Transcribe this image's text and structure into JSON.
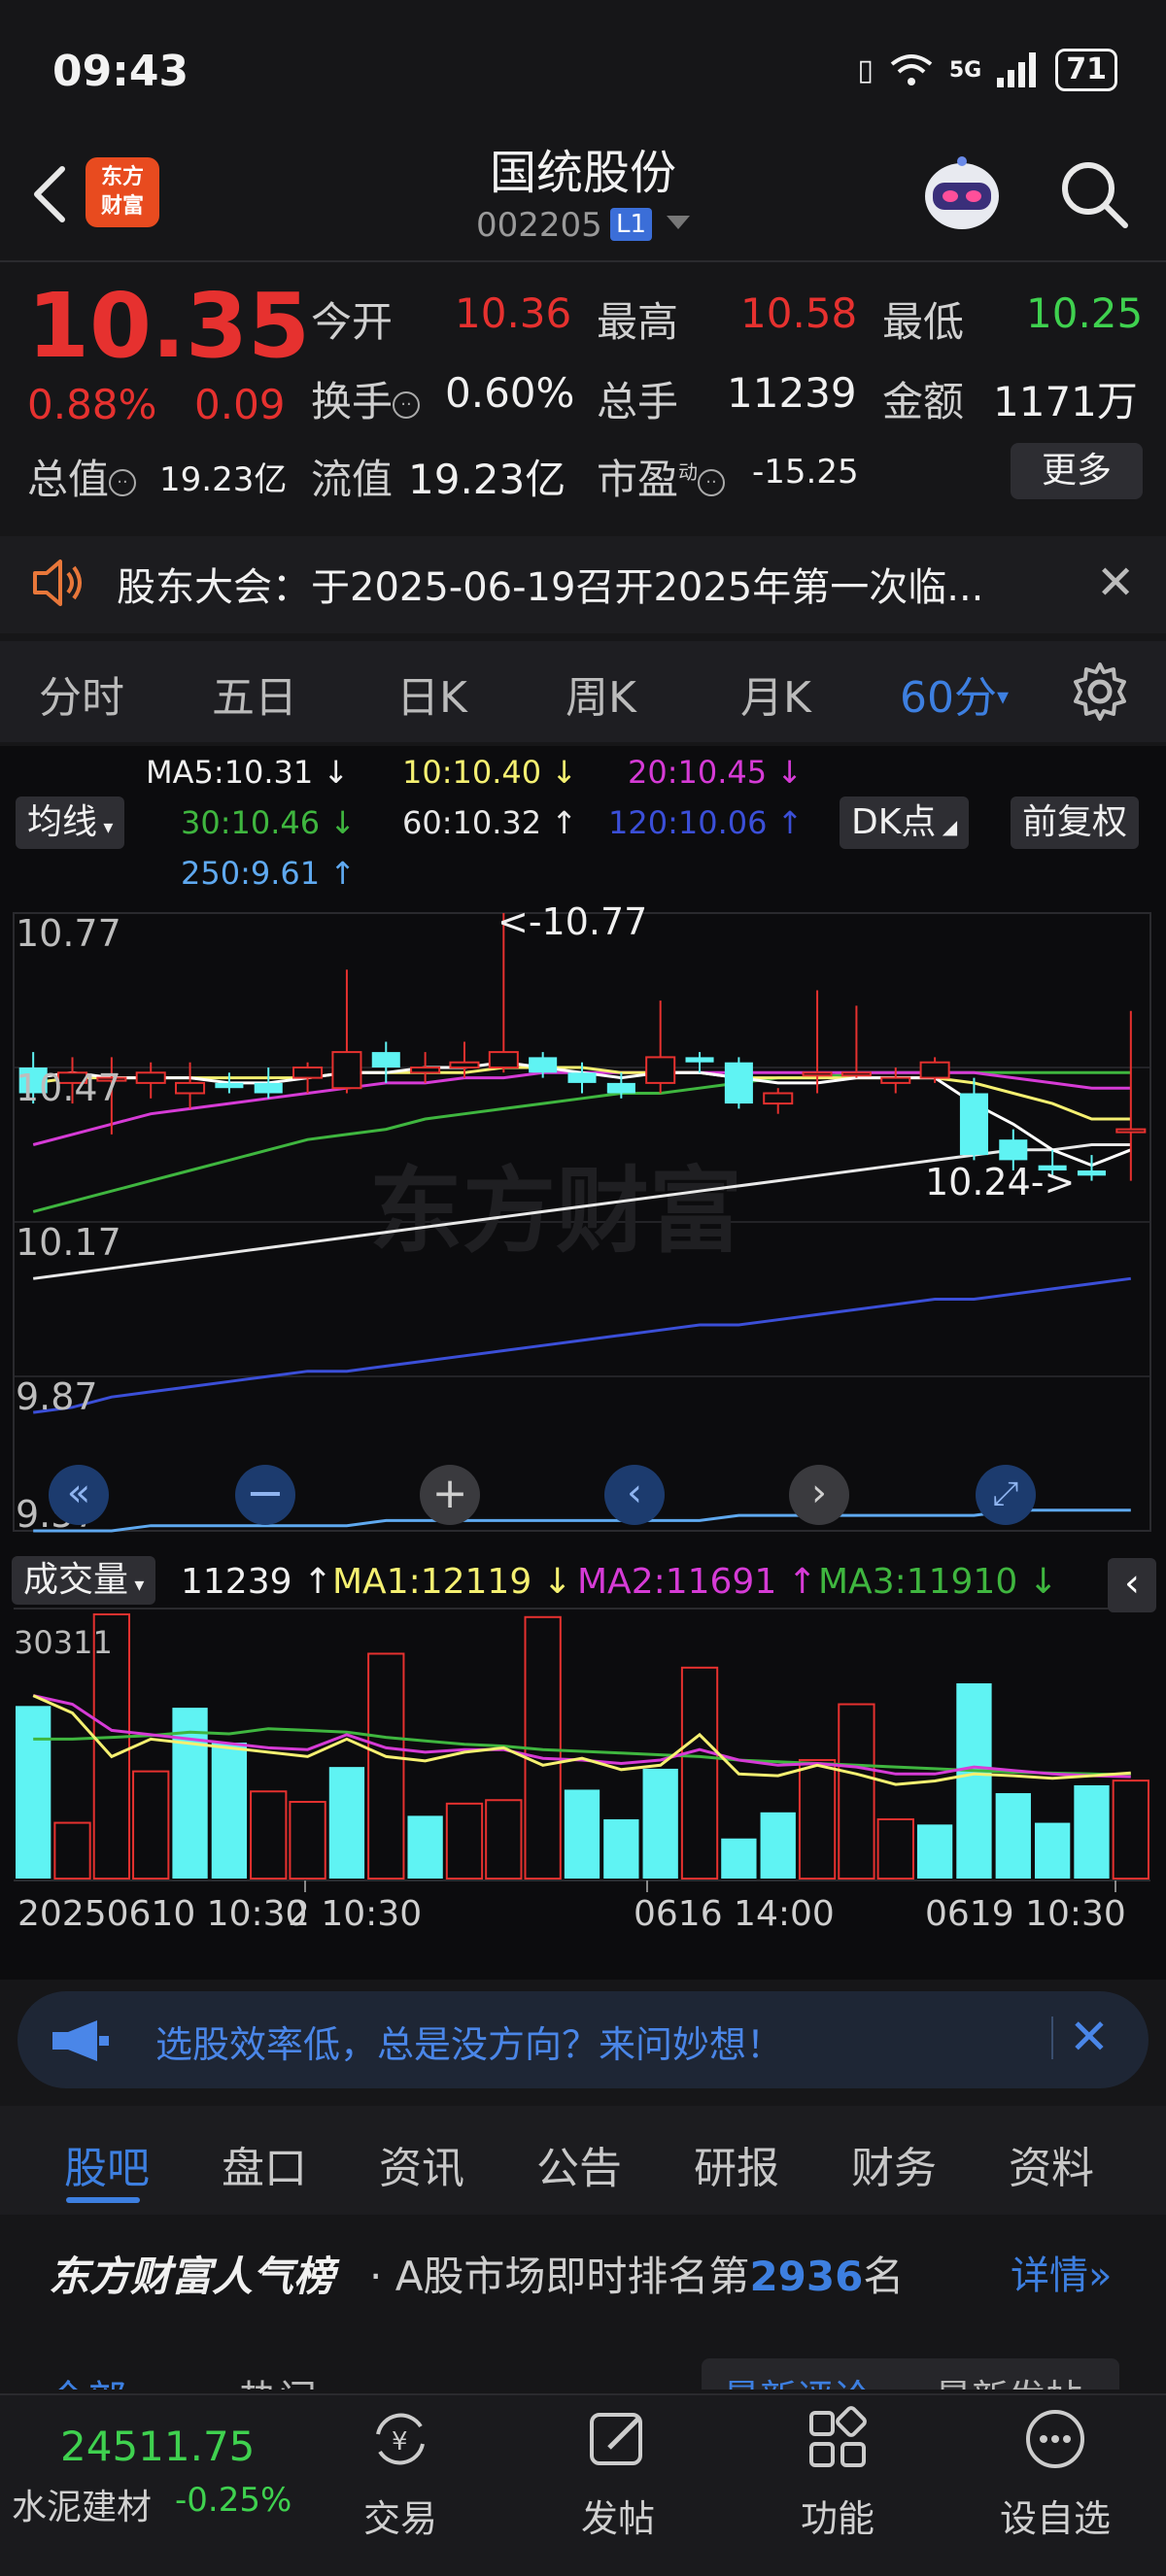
{
  "status_bar": {
    "time": "09:43",
    "network": "5G",
    "battery": "71"
  },
  "header": {
    "logo_text_1": "东方",
    "logo_text_2": "财富",
    "stock_name": "国统股份",
    "stock_code": "002205",
    "level_badge": "L1"
  },
  "quote": {
    "price": "10.35",
    "change_pct": "0.88%",
    "change": "0.09",
    "open_label": "今开",
    "open": "10.36",
    "high_label": "最高",
    "high": "10.58",
    "low_label": "最低",
    "low": "10.25",
    "turnover_label": "换手",
    "turnover": "0.60%",
    "volume_label": "总手",
    "volume": "11239",
    "amount_label": "金额",
    "amount": "1171万",
    "mktcap_label": "总值",
    "mktcap": "19.23亿",
    "float_label": "流值",
    "float_cap": "19.23亿",
    "pe_label": "市盈",
    "pe_sup": "动",
    "pe": "-15.25",
    "more_label": "更多"
  },
  "notice": {
    "text": "股东大会：于2025-06-19召开2025年第一次临..."
  },
  "period_tabs": [
    "分时",
    "五日",
    "日K",
    "周K",
    "月K",
    "60分"
  ],
  "active_period": "60分",
  "chart_controls": {
    "ma_button": "均线",
    "dk_button": "DK点",
    "adjust_button": "前复权",
    "volume_button": "成交量"
  },
  "ma_legend": {
    "ma5": "MA5:10.31 ↓",
    "ma10": "10:10.40 ↓",
    "ma20": "20:10.45 ↓",
    "ma30": "30:10.46 ↓",
    "ma60": "60:10.32 ↑",
    "ma120": "120:10.06 ↑",
    "ma250": "250:9.61 ↑"
  },
  "volume_legend": {
    "vol": "11239 ↑",
    "ma1": "MA1:12119 ↓",
    "ma2": "MA2:11691 ↑",
    "ma3": "MA3:11910 ↓"
  },
  "axis": {
    "price_ticks": [
      "10.77",
      "10.47",
      "10.17",
      "9.87",
      "9.57"
    ],
    "vol_tick": "30311",
    "max_marker": "<-10.77",
    "min_marker": "10.24->",
    "time_labels": [
      "20250610 10:30",
      "2 10:30",
      "0616 14:00",
      "0619 10:30"
    ]
  },
  "watermark": "东方财富",
  "colors": {
    "up": "#e6312f",
    "down": "#5ff3f3",
    "ma5": "#ffffff",
    "ma10": "#f5f071",
    "ma20": "#d63bd6",
    "ma30": "#3fb63f",
    "ma60": "#e8e8e8",
    "ma120": "#3b4fd8",
    "ma250": "#5fa9f0"
  },
  "chart_data": {
    "type": "candlestick",
    "interval": "60分",
    "ylim": [
      9.57,
      10.77
    ],
    "candles": [
      {
        "o": 10.47,
        "c": 10.42,
        "h": 10.5,
        "l": 10.4
      },
      {
        "o": 10.44,
        "c": 10.46,
        "h": 10.49,
        "l": 10.4
      },
      {
        "o": 10.45,
        "c": 10.45,
        "h": 10.49,
        "l": 10.34
      },
      {
        "o": 10.44,
        "c": 10.46,
        "h": 10.48,
        "l": 10.41
      },
      {
        "o": 10.42,
        "c": 10.44,
        "h": 10.48,
        "l": 10.39
      },
      {
        "o": 10.44,
        "c": 10.43,
        "h": 10.46,
        "l": 10.42
      },
      {
        "o": 10.44,
        "c": 10.42,
        "h": 10.47,
        "l": 10.41
      },
      {
        "o": 10.45,
        "c": 10.47,
        "h": 10.48,
        "l": 10.42
      },
      {
        "o": 10.43,
        "c": 10.5,
        "h": 10.66,
        "l": 10.42
      },
      {
        "o": 10.5,
        "c": 10.47,
        "h": 10.52,
        "l": 10.44
      },
      {
        "o": 10.46,
        "c": 10.47,
        "h": 10.5,
        "l": 10.44
      },
      {
        "o": 10.47,
        "c": 10.48,
        "h": 10.52,
        "l": 10.45
      },
      {
        "o": 10.47,
        "c": 10.5,
        "h": 10.77,
        "l": 10.46
      },
      {
        "o": 10.49,
        "c": 10.46,
        "h": 10.5,
        "l": 10.45
      },
      {
        "o": 10.46,
        "c": 10.44,
        "h": 10.48,
        "l": 10.42
      },
      {
        "o": 10.44,
        "c": 10.42,
        "h": 10.46,
        "l": 10.41
      },
      {
        "o": 10.44,
        "c": 10.49,
        "h": 10.6,
        "l": 10.42
      },
      {
        "o": 10.49,
        "c": 10.48,
        "h": 10.5,
        "l": 10.46
      },
      {
        "o": 10.48,
        "c": 10.4,
        "h": 10.49,
        "l": 10.39
      },
      {
        "o": 10.4,
        "c": 10.42,
        "h": 10.43,
        "l": 10.38
      },
      {
        "o": 10.46,
        "c": 10.46,
        "h": 10.62,
        "l": 10.42
      },
      {
        "o": 10.46,
        "c": 10.46,
        "h": 10.59,
        "l": 10.45
      },
      {
        "o": 10.44,
        "c": 10.45,
        "h": 10.47,
        "l": 10.42
      },
      {
        "o": 10.45,
        "c": 10.48,
        "h": 10.49,
        "l": 10.44
      },
      {
        "o": 10.42,
        "c": 10.3,
        "h": 10.45,
        "l": 10.29
      },
      {
        "o": 10.33,
        "c": 10.29,
        "h": 10.35,
        "l": 10.27
      },
      {
        "o": 10.28,
        "c": 10.27,
        "h": 10.31,
        "l": 10.26
      },
      {
        "o": 10.27,
        "c": 10.26,
        "h": 10.3,
        "l": 10.25
      },
      {
        "o": 10.35,
        "c": 10.35,
        "h": 10.58,
        "l": 10.25
      }
    ],
    "ma_lines": {
      "ma5": [
        10.45,
        10.46,
        10.45,
        10.45,
        10.45,
        10.44,
        10.44,
        10.45,
        10.46,
        10.46,
        10.47,
        10.47,
        10.48,
        10.47,
        10.46,
        10.45,
        10.46,
        10.46,
        10.45,
        10.44,
        10.44,
        10.45,
        10.45,
        10.45,
        10.4,
        10.36,
        10.31,
        10.28,
        10.31
      ],
      "ma10": [
        10.44,
        10.45,
        10.45,
        10.45,
        10.45,
        10.45,
        10.45,
        10.45,
        10.46,
        10.46,
        10.46,
        10.46,
        10.47,
        10.47,
        10.47,
        10.46,
        10.46,
        10.46,
        10.45,
        10.45,
        10.45,
        10.45,
        10.45,
        10.45,
        10.44,
        10.42,
        10.4,
        10.37,
        10.37
      ],
      "ma20": [
        10.32,
        10.34,
        10.36,
        10.38,
        10.39,
        10.4,
        10.41,
        10.42,
        10.43,
        10.44,
        10.44,
        10.45,
        10.45,
        10.46,
        10.46,
        10.46,
        10.46,
        10.46,
        10.46,
        10.46,
        10.46,
        10.46,
        10.46,
        10.46,
        10.46,
        10.45,
        10.44,
        10.43,
        10.43
      ],
      "ma30": [
        10.19,
        10.21,
        10.23,
        10.25,
        10.27,
        10.29,
        10.31,
        10.33,
        10.34,
        10.35,
        10.37,
        10.38,
        10.39,
        10.4,
        10.41,
        10.42,
        10.42,
        10.43,
        10.44,
        10.45,
        10.45,
        10.46,
        10.46,
        10.46,
        10.46,
        10.46,
        10.46,
        10.46,
        10.46
      ],
      "ma60": [
        10.06,
        10.07,
        10.08,
        10.09,
        10.1,
        10.11,
        10.12,
        10.13,
        10.14,
        10.15,
        10.16,
        10.17,
        10.18,
        10.19,
        10.2,
        10.21,
        10.22,
        10.23,
        10.24,
        10.25,
        10.26,
        10.27,
        10.28,
        10.29,
        10.3,
        10.31,
        10.31,
        10.32,
        10.32
      ],
      "ma120": [
        9.8,
        9.81,
        9.83,
        9.84,
        9.85,
        9.86,
        9.87,
        9.88,
        9.88,
        9.89,
        9.9,
        9.91,
        9.92,
        9.93,
        9.94,
        9.95,
        9.96,
        9.97,
        9.97,
        9.98,
        9.99,
        10.0,
        10.01,
        10.02,
        10.02,
        10.03,
        10.04,
        10.05,
        10.06
      ],
      "ma250": [
        9.57,
        9.57,
        9.57,
        9.58,
        9.58,
        9.58,
        9.58,
        9.58,
        9.58,
        9.59,
        9.59,
        9.59,
        9.59,
        9.59,
        9.59,
        9.59,
        9.59,
        9.59,
        9.6,
        9.6,
        9.6,
        9.6,
        9.6,
        9.6,
        9.6,
        9.61,
        9.61,
        9.61,
        9.61
      ]
    },
    "volume": {
      "ymax": 30311,
      "bars": [
        19800,
        6400,
        30311,
        12300,
        19600,
        15600,
        10000,
        8800,
        12800,
        25800,
        7200,
        8600,
        9000,
        30000,
        10200,
        6800,
        12600,
        24200,
        4600,
        7600,
        13600,
        20000,
        6800,
        6200,
        22400,
        9800,
        6400,
        10700,
        11239
      ],
      "up": [
        false,
        true,
        true,
        true,
        false,
        false,
        true,
        true,
        false,
        true,
        false,
        true,
        true,
        true,
        false,
        false,
        false,
        true,
        false,
        false,
        true,
        true,
        true,
        false,
        false,
        false,
        false,
        false,
        true
      ],
      "ma1": [
        21000,
        19000,
        14000,
        16000,
        15500,
        15000,
        14500,
        14000,
        16000,
        14000,
        13500,
        14500,
        15000,
        13000,
        13800,
        12500,
        13000,
        16500,
        12000,
        11800,
        13000,
        12000,
        10800,
        11200,
        12000,
        11800,
        11500,
        11800,
        12119
      ],
      "ma2": [
        21000,
        20000,
        17000,
        16500,
        16000,
        15500,
        15000,
        14800,
        16500,
        15000,
        14500,
        14800,
        14800,
        13800,
        13600,
        13200,
        13600,
        14800,
        13600,
        13000,
        13200,
        12800,
        12000,
        12000,
        12800,
        12400,
        12000,
        11800,
        11691
      ],
      "ma3": [
        16000,
        16000,
        16200,
        16400,
        16800,
        16600,
        17200,
        17000,
        16800,
        16200,
        15800,
        15400,
        15200,
        14800,
        14600,
        14400,
        14200,
        14000,
        13600,
        13400,
        13200,
        13000,
        12800,
        12600,
        12400,
        12200,
        12100,
        12000,
        11910
      ]
    }
  },
  "banner": {
    "text": "选股效率低，总是没方向？来问妙想！"
  },
  "content_tabs": [
    "股吧",
    "盘口",
    "资讯",
    "公告",
    "研报",
    "财务",
    "资料"
  ],
  "rank": {
    "title": "东方财富人气榜",
    "text_prefix": "· A股市场即时排名第",
    "rank_number": "2936",
    "text_suffix": "名",
    "detail": "详情"
  },
  "sub_tabs": {
    "all": "全部",
    "hot": "热门",
    "latest_comment": "最新评论",
    "latest_post": "最新发帖"
  },
  "bottom_nav": {
    "index_value": "24511.75",
    "index_name": "水泥建材",
    "index_pct": "-0.25%",
    "items": [
      "交易",
      "发帖",
      "功能",
      "设自选"
    ]
  }
}
